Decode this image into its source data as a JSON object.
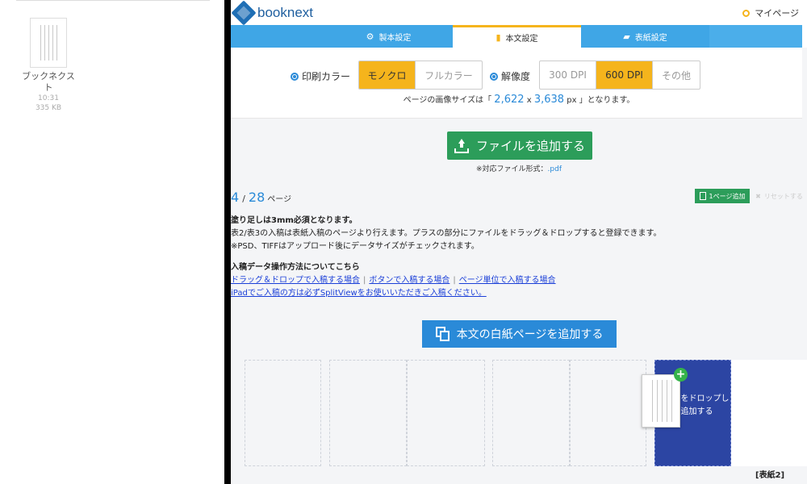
{
  "file_panel": {
    "file_name": "ブックネクスト",
    "file_time": "10:31",
    "file_size": "335 KB"
  },
  "header": {
    "logo_text": "booknext",
    "mypage_label": "マイページ"
  },
  "tabs": [
    {
      "label": "製本設定",
      "icon": "gear-icon"
    },
    {
      "label": "本文設定",
      "icon": "document-icon",
      "active": true
    },
    {
      "label": "表紙設定",
      "icon": "book-icon"
    }
  ],
  "print_color": {
    "label": "印刷カラー",
    "options": [
      "モノクロ",
      "フルカラー"
    ],
    "selected": "モノクロ"
  },
  "resolution": {
    "label": "解像度",
    "options": [
      "300 DPI",
      "600 DPI",
      "その他"
    ],
    "selected": "600 DPI"
  },
  "image_size": {
    "prefix": "ページの画像サイズは「",
    "width": "2,622",
    "x": "x",
    "height": "3,638",
    "suffix": "px 」となります。"
  },
  "upload": {
    "button_label": "ファイルを追加する",
    "formats_label": "※対応ファイル形式：",
    "formats_value": ".pdf"
  },
  "pages": {
    "current": "4",
    "separator": "/",
    "total": "28",
    "unit": "ページ",
    "add_one_label": "1ページ追加",
    "reset_label": "リセットする"
  },
  "notes": {
    "line1": "塗り足しは3mm必須となります。",
    "line2": "表2/表3の入稿は表紙入稿のページより行えます。プラスの部分にファイルをドラッグ＆ドロップすると登録できます。",
    "line3": "※PSD、TIFFはアップロード後にデータサイズがチェックされます。",
    "howto_title": "入稿データ操作方法についてこちら",
    "link1": "ドラッグ＆ドロップで入稿する場合",
    "link2": "ボタンで入稿する場合",
    "link3": "ページ単位で入稿する場合",
    "link_sep": "|",
    "ipad_link": "iPadでご入稿の方は必ずSplitViewをお使いいただきご入稿ください。"
  },
  "blank_page": {
    "button_label": "本文の白紙ページを追加する"
  },
  "slots": {
    "drop_text": "ァイルをドロップして追加する",
    "cover_label": "[表紙2]"
  },
  "colors": {
    "accent_blue": "#3fa6e6",
    "link_blue": "#2a8ad8",
    "selected_yellow": "#f5b41c",
    "action_green": "#2c9d5a",
    "drop_navy": "#2c45a3"
  }
}
